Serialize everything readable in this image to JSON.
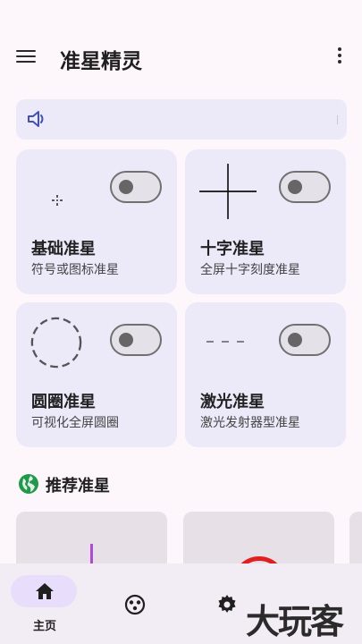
{
  "app": {
    "title": "准星精灵"
  },
  "icons": {
    "menu": "menu-icon",
    "more": "more-vert-icon",
    "speaker": "speaker-icon",
    "globe": "globe-icon",
    "home": "home-icon",
    "apps": "apps-icon",
    "settings": "settings-icon"
  },
  "notice": {
    "text": ""
  },
  "cards": [
    {
      "title": "基础准星",
      "subtitle": "符号或图标准星",
      "toggle": "off"
    },
    {
      "title": "十字准星",
      "subtitle": "全屏十字刻度准星",
      "toggle": "off"
    },
    {
      "title": "圆圈准星",
      "subtitle": "可视化全屏圆圈",
      "toggle": "off"
    },
    {
      "title": "激光准星",
      "subtitle": "激光发射器型准星",
      "toggle": "off"
    }
  ],
  "recommend": {
    "title": "推荐准星"
  },
  "bottom_nav": [
    {
      "label": "主页",
      "icon": "home-icon",
      "active": true
    },
    {
      "label": "",
      "icon": "apps-icon",
      "active": false
    },
    {
      "label": "",
      "icon": "settings-icon",
      "active": false
    }
  ],
  "watermark": {
    "text": "大玩客"
  },
  "colors": {
    "accent_pill": "#e8defb",
    "card_bg": "#ece9f9",
    "notice_icon": "#3f51b5",
    "globe": "#1e9a4a",
    "laser_purple": "#b04ad9",
    "red_ring": "#e02020"
  }
}
